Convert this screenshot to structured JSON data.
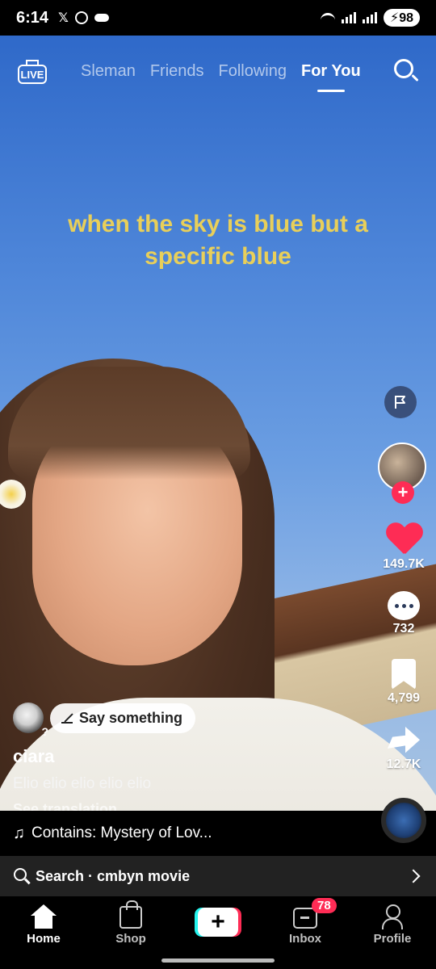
{
  "status_bar": {
    "time": "6:14",
    "notif_icons": [
      "x-logo-icon",
      "whatsapp-icon",
      "cloud-icon"
    ],
    "x_glyph": "𝕏",
    "battery": "98"
  },
  "top_nav": {
    "live_label": "LIVE",
    "tabs": [
      {
        "label": "Sleman",
        "active": false
      },
      {
        "label": "Friends",
        "active": false
      },
      {
        "label": "Following",
        "active": false
      },
      {
        "label": "For You",
        "active": true
      }
    ]
  },
  "video": {
    "caption": "when the sky is blue but a specific blue"
  },
  "right_rail": {
    "likes": "149.7K",
    "comments": "732",
    "saves": "4,799",
    "shares": "12.7K"
  },
  "author": {
    "username": "ciara",
    "say_something": "Say something",
    "description": "Elio elio elio elio elio",
    "see_translation": "See translation"
  },
  "sound": {
    "label": "Contains: Mystery of Lov..."
  },
  "search_suggestion": {
    "text": "Search · cmbyn movie"
  },
  "bottom_nav": {
    "home": "Home",
    "shop": "Shop",
    "inbox": "Inbox",
    "inbox_badge": "78",
    "profile": "Profile"
  },
  "colors": {
    "accent_red": "#fe2c55",
    "accent_cyan": "#25f4ee",
    "caption_yellow": "#e8cf5a"
  }
}
